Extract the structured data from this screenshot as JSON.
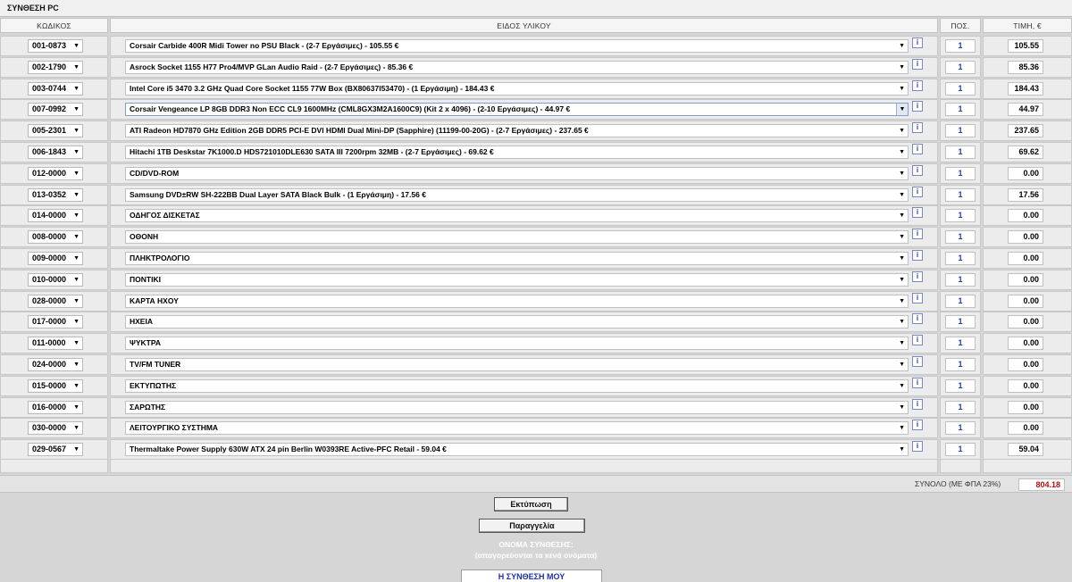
{
  "page": {
    "title": "ΣΥΝΘΕΣΗ PC"
  },
  "columns": {
    "code": "ΚΩΔΙΚΟΣ",
    "item": "ΕΙΔΟΣ ΥΛΙΚΟΥ",
    "qty": "ΠΟΣ.",
    "price": "ΤΙΜΗ, €"
  },
  "rows": [
    {
      "code": "001-0873",
      "item": "Corsair Carbide 400R Midi Tower no PSU Black - (2-7 Εργάσιμες) - 105.55 €",
      "qty": "1",
      "price": "105.55"
    },
    {
      "code": "002-1790",
      "item": "Asrock Socket 1155 H77 Pro4/MVP GLan Audio Raid - (2-7 Εργάσιμες) - 85.36 €",
      "qty": "1",
      "price": "85.36"
    },
    {
      "code": "003-0744",
      "item": "Intel Core i5 3470 3.2 GHz Quad Core Socket 1155 77W Box (BX80637I53470) - (1 Εργάσιμη) - 184.43 €",
      "qty": "1",
      "price": "184.43"
    },
    {
      "code": "007-0992",
      "item": "Corsair Vengeance LP 8GB DDR3 Non ECC CL9 1600MHz (CML8GX3M2A1600C9) (Kit 2 x 4096) - (2-10 Εργάσιμες) - 44.97 €",
      "qty": "1",
      "price": "44.97"
    },
    {
      "code": "005-2301",
      "item": "ATI Radeon HD7870 GHz Edition 2GB DDR5 PCI-E DVI HDMI Dual Mini-DP (Sapphire) (11199-00-20G) - (2-7 Εργάσιμες) - 237.65 €",
      "qty": "1",
      "price": "237.65"
    },
    {
      "code": "006-1843",
      "item": "Hitachi 1TB Deskstar 7K1000.D HDS721010DLE630 SATA III 7200rpm 32MB - (2-7 Εργάσιμες) - 69.62 €",
      "qty": "1",
      "price": "69.62"
    },
    {
      "code": "012-0000",
      "item": "CD/DVD-ROM",
      "qty": "1",
      "price": "0.00"
    },
    {
      "code": "013-0352",
      "item": "Samsung DVD±RW SH-222BB Dual Layer SATA Black Bulk - (1 Εργάσιμη) - 17.56 €",
      "qty": "1",
      "price": "17.56"
    },
    {
      "code": "014-0000",
      "item": "ΟΔΗΓΟΣ ΔΙΣΚΕΤΑΣ",
      "qty": "1",
      "price": "0.00"
    },
    {
      "code": "008-0000",
      "item": "ΟΘΟΝΗ",
      "qty": "1",
      "price": "0.00"
    },
    {
      "code": "009-0000",
      "item": "ΠΛΗΚΤΡΟΛΟΓΙΟ",
      "qty": "1",
      "price": "0.00"
    },
    {
      "code": "010-0000",
      "item": "ΠΟΝΤΙΚΙ",
      "qty": "1",
      "price": "0.00"
    },
    {
      "code": "028-0000",
      "item": "ΚΑΡΤΑ ΗΧΟΥ",
      "qty": "1",
      "price": "0.00"
    },
    {
      "code": "017-0000",
      "item": "ΗΧΕΙΑ",
      "qty": "1",
      "price": "0.00"
    },
    {
      "code": "011-0000",
      "item": "ΨΥΚΤΡΑ",
      "qty": "1",
      "price": "0.00"
    },
    {
      "code": "024-0000",
      "item": "TV/FM TUNER",
      "qty": "1",
      "price": "0.00"
    },
    {
      "code": "015-0000",
      "item": "ΕΚΤΥΠΩΤΗΣ",
      "qty": "1",
      "price": "0.00"
    },
    {
      "code": "016-0000",
      "item": "ΣΑΡΩΤΗΣ",
      "qty": "1",
      "price": "0.00"
    },
    {
      "code": "030-0000",
      "item": "ΛΕΙΤΟΥΡΓΙΚΟ ΣΥΣΤΗΜΑ",
      "qty": "1",
      "price": "0.00"
    },
    {
      "code": "029-0567",
      "item": "Thermaltake Power Supply 630W ATX 24 pin Berlin W0393RE Active-PFC Retail - 59.04 €",
      "qty": "1",
      "price": "59.04"
    }
  ],
  "info_label": "i",
  "total": {
    "label": "ΣΥΝΟΛΟ (ΜΕ ΦΠΑ 23%)",
    "value": "804.18"
  },
  "buttons": {
    "print": "Εκτύπωση",
    "order": "Παραγγελία"
  },
  "build_name": {
    "label": "ΟΝΟΜΑ ΣΥΝΘΕΣΗΣ:",
    "hint": "(απαγορεύονται τα κενά ονόματα)",
    "value": "Η ΣΥΝΘΕΣΗ ΜΟΥ"
  },
  "colors": {
    "total_value": "#b01010",
    "qty_text": "#1a3fb0",
    "name_value": "#1a2fb0"
  }
}
